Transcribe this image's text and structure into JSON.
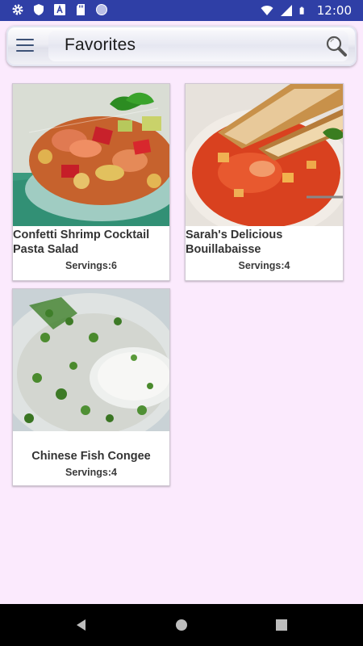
{
  "status_bar": {
    "time": "12:00"
  },
  "app_bar": {
    "title": "Favorites"
  },
  "recipes": [
    {
      "name": "Confetti Shrimp Cocktail Pasta Salad",
      "servings": "Servings:6"
    },
    {
      "name": "Sarah's Delicious Bouillabaisse",
      "servings": "Servings:4"
    },
    {
      "name": "Chinese Fish Congee",
      "servings": "Servings:4"
    }
  ],
  "icons": {
    "status_left": [
      "gear-icon",
      "shield-icon",
      "text-a-icon",
      "sd-card-icon",
      "circle-icon"
    ],
    "status_right": [
      "wifi-icon",
      "signal-icon",
      "battery-icon"
    ],
    "app_bar": [
      "hamburger-menu-icon",
      "search-icon"
    ],
    "navigation": [
      "back-icon",
      "home-icon",
      "recents-icon"
    ]
  },
  "colors": {
    "status_bar": "#2f3fa6",
    "background": "#fbeafd",
    "nav_bar": "#000000"
  }
}
